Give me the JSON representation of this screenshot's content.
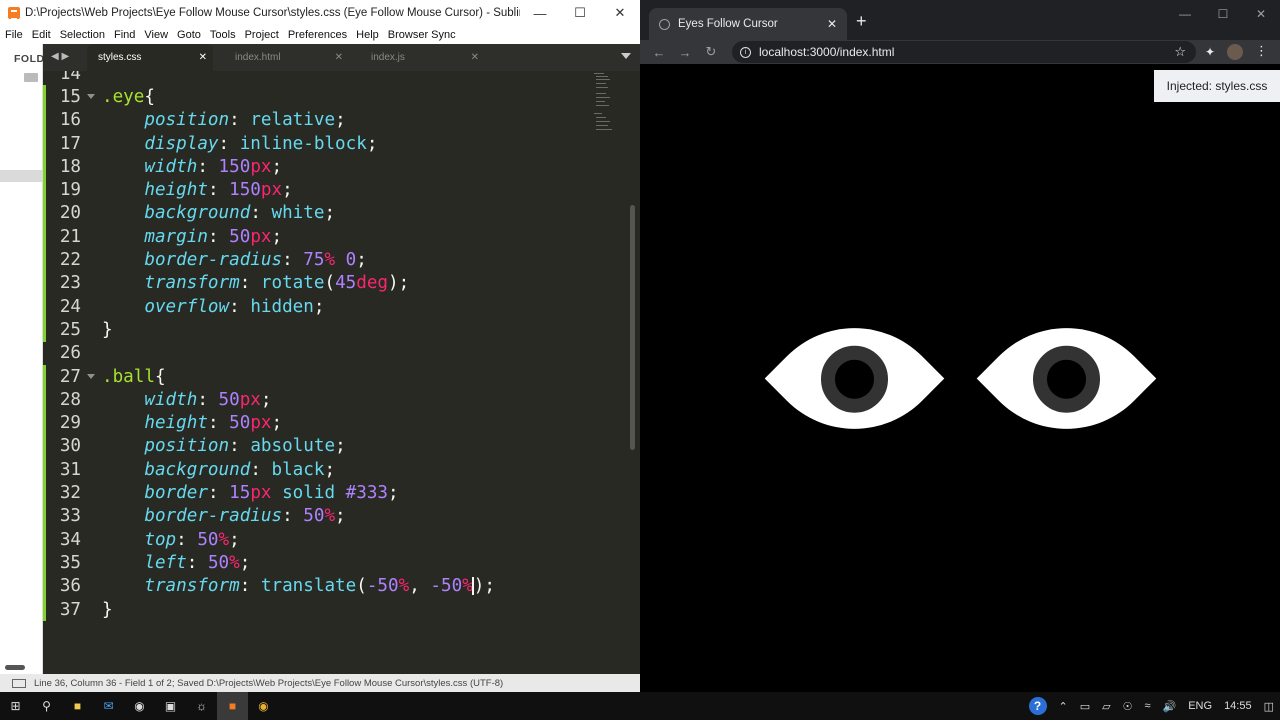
{
  "sublime": {
    "title": "D:\\Projects\\Web Projects\\Eye Follow Mouse Cursor\\styles.css (Eye Follow Mouse Cursor) - Sublime Text (UNREG...",
    "menu": [
      "File",
      "Edit",
      "Selection",
      "Find",
      "View",
      "Goto",
      "Tools",
      "Project",
      "Preferences",
      "Help",
      "Browser Sync"
    ],
    "sidebar_label": "FOLD",
    "tabs": [
      {
        "label": "styles.css",
        "active": true
      },
      {
        "label": "index.html",
        "active": false
      },
      {
        "label": "index.js",
        "active": false
      }
    ],
    "status": "Line 36, Column 36 - Field 1 of 2; Saved D:\\Projects\\Web Projects\\Eye Follow Mouse Cursor\\styles.css (UTF-8)",
    "code_lines": [
      {
        "n": "14",
        "t": []
      },
      {
        "n": "15",
        "t": [
          [
            "sel-c",
            ".eye"
          ],
          [
            "txt",
            "{"
          ]
        ]
      },
      {
        "n": "16",
        "t": [
          [
            "txt",
            "    "
          ],
          [
            "p",
            "position"
          ],
          [
            "txt",
            ": "
          ],
          [
            "val",
            "relative"
          ],
          [
            "txt",
            ";"
          ]
        ]
      },
      {
        "n": "17",
        "t": [
          [
            "txt",
            "    "
          ],
          [
            "p",
            "display"
          ],
          [
            "txt",
            ": "
          ],
          [
            "val",
            "inline-block"
          ],
          [
            "txt",
            ";"
          ]
        ]
      },
      {
        "n": "18",
        "t": [
          [
            "txt",
            "    "
          ],
          [
            "p",
            "width"
          ],
          [
            "txt",
            ": "
          ],
          [
            "num",
            "150"
          ],
          [
            "unit",
            "px"
          ],
          [
            "txt",
            ";"
          ]
        ]
      },
      {
        "n": "19",
        "t": [
          [
            "txt",
            "    "
          ],
          [
            "p",
            "height"
          ],
          [
            "txt",
            ": "
          ],
          [
            "num",
            "150"
          ],
          [
            "unit",
            "px"
          ],
          [
            "txt",
            ";"
          ]
        ]
      },
      {
        "n": "20",
        "t": [
          [
            "txt",
            "    "
          ],
          [
            "p",
            "background"
          ],
          [
            "txt",
            ": "
          ],
          [
            "val",
            "white"
          ],
          [
            "txt",
            ";"
          ]
        ]
      },
      {
        "n": "21",
        "t": [
          [
            "txt",
            "    "
          ],
          [
            "p",
            "margin"
          ],
          [
            "txt",
            ": "
          ],
          [
            "num",
            "50"
          ],
          [
            "unit",
            "px"
          ],
          [
            "txt",
            ";"
          ]
        ]
      },
      {
        "n": "22",
        "t": [
          [
            "txt",
            "    "
          ],
          [
            "p",
            "border-radius"
          ],
          [
            "txt",
            ": "
          ],
          [
            "num",
            "75"
          ],
          [
            "unit",
            "%"
          ],
          [
            "txt",
            " "
          ],
          [
            "num",
            "0"
          ],
          [
            "txt",
            ";"
          ]
        ]
      },
      {
        "n": "23",
        "t": [
          [
            "txt",
            "    "
          ],
          [
            "p",
            "transform"
          ],
          [
            "txt",
            ": "
          ],
          [
            "val",
            "rotate"
          ],
          [
            "txt",
            "("
          ],
          [
            "num",
            "45"
          ],
          [
            "unit",
            "deg"
          ],
          [
            "txt",
            ");"
          ]
        ]
      },
      {
        "n": "24",
        "t": [
          [
            "txt",
            "    "
          ],
          [
            "p",
            "overflow"
          ],
          [
            "txt",
            ": "
          ],
          [
            "val",
            "hidden"
          ],
          [
            "txt",
            ";"
          ]
        ]
      },
      {
        "n": "25",
        "t": [
          [
            "txt",
            "}"
          ]
        ]
      },
      {
        "n": "26",
        "t": []
      },
      {
        "n": "27",
        "t": [
          [
            "sel-c",
            ".ball"
          ],
          [
            "txt",
            "{"
          ]
        ]
      },
      {
        "n": "28",
        "t": [
          [
            "txt",
            "    "
          ],
          [
            "p",
            "width"
          ],
          [
            "txt",
            ": "
          ],
          [
            "num",
            "50"
          ],
          [
            "unit",
            "px"
          ],
          [
            "txt",
            ";"
          ]
        ]
      },
      {
        "n": "29",
        "t": [
          [
            "txt",
            "    "
          ],
          [
            "p",
            "height"
          ],
          [
            "txt",
            ": "
          ],
          [
            "num",
            "50"
          ],
          [
            "unit",
            "px"
          ],
          [
            "txt",
            ";"
          ]
        ]
      },
      {
        "n": "30",
        "t": [
          [
            "txt",
            "    "
          ],
          [
            "p",
            "position"
          ],
          [
            "txt",
            ": "
          ],
          [
            "val",
            "absolute"
          ],
          [
            "txt",
            ";"
          ]
        ]
      },
      {
        "n": "31",
        "t": [
          [
            "txt",
            "    "
          ],
          [
            "p",
            "background"
          ],
          [
            "txt",
            ": "
          ],
          [
            "val",
            "black"
          ],
          [
            "txt",
            ";"
          ]
        ]
      },
      {
        "n": "32",
        "t": [
          [
            "txt",
            "    "
          ],
          [
            "p",
            "border"
          ],
          [
            "txt",
            ": "
          ],
          [
            "num",
            "15"
          ],
          [
            "unit",
            "px"
          ],
          [
            "txt",
            " "
          ],
          [
            "val",
            "solid"
          ],
          [
            "txt",
            " "
          ],
          [
            "num",
            "#333"
          ],
          [
            "txt",
            ";"
          ]
        ]
      },
      {
        "n": "33",
        "t": [
          [
            "txt",
            "    "
          ],
          [
            "p",
            "border-radius"
          ],
          [
            "txt",
            ": "
          ],
          [
            "num",
            "50"
          ],
          [
            "unit",
            "%"
          ],
          [
            "txt",
            ";"
          ]
        ]
      },
      {
        "n": "34",
        "t": [
          [
            "txt",
            "    "
          ],
          [
            "p",
            "top"
          ],
          [
            "txt",
            ": "
          ],
          [
            "num",
            "50"
          ],
          [
            "unit",
            "%"
          ],
          [
            "txt",
            ";"
          ]
        ]
      },
      {
        "n": "35",
        "t": [
          [
            "txt",
            "    "
          ],
          [
            "p",
            "left"
          ],
          [
            "txt",
            ": "
          ],
          [
            "num",
            "50"
          ],
          [
            "unit",
            "%"
          ],
          [
            "txt",
            ";"
          ]
        ]
      },
      {
        "n": "36",
        "t": [
          [
            "txt",
            "    "
          ],
          [
            "p",
            "transform"
          ],
          [
            "txt",
            ": "
          ],
          [
            "val",
            "translate"
          ],
          [
            "txt",
            "("
          ],
          [
            "num",
            "-50"
          ],
          [
            "unit",
            "%"
          ],
          [
            "txt",
            ", "
          ],
          [
            "num",
            "-50"
          ],
          [
            "unit",
            "%"
          ],
          [
            "cursor",
            ""
          ],
          [
            "txt",
            ");"
          ]
        ]
      },
      {
        "n": "37",
        "t": [
          [
            "txt",
            "}"
          ]
        ]
      }
    ]
  },
  "chrome": {
    "tab_title": "Eyes Follow Cursor",
    "url": "localhost:3000/index.html",
    "notice": "Injected: styles.css"
  },
  "taskbar": {
    "lang": "ENG",
    "time": "14:55"
  }
}
